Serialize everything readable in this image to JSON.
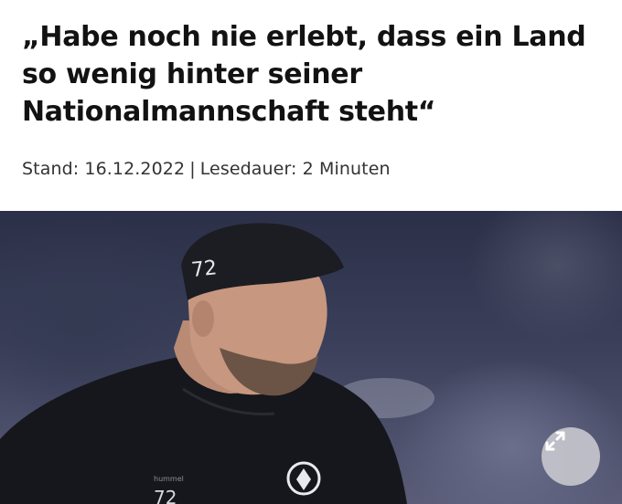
{
  "article": {
    "headline": "„Habe noch nie erlebt, dass ein Land so wenig hinter seiner Nationalmannschaft steht“",
    "meta": {
      "date": "Stand: 16.12.2022",
      "separator": "|",
      "reading_time": "Lesedauer: 2 Minuten"
    }
  },
  "photo": {
    "cap_number": "72",
    "shirt_number": "72",
    "shirt_brand": "hummel"
  },
  "icons": {
    "expand": "expand-arrows-icon"
  }
}
